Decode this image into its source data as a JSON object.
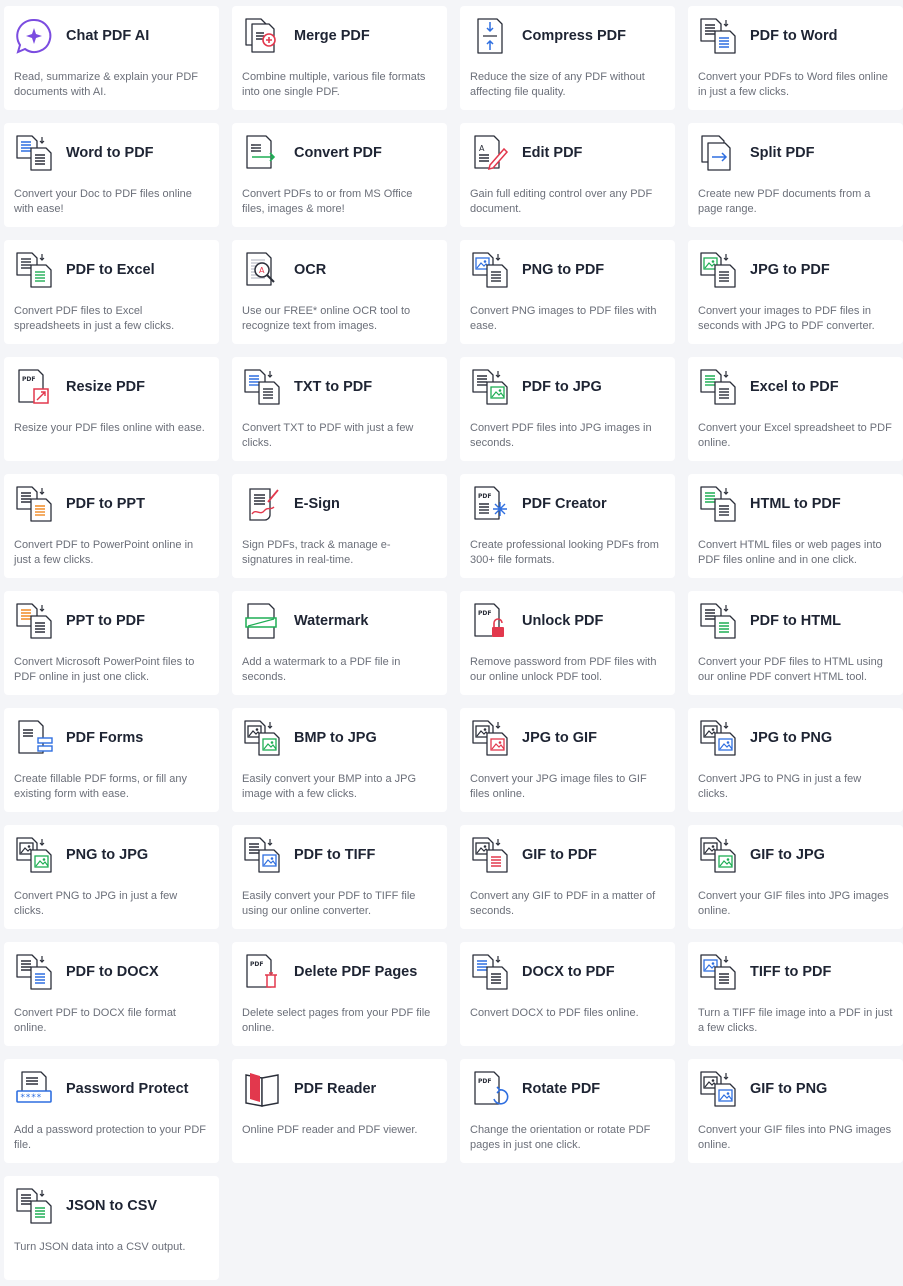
{
  "tools": [
    {
      "title": "Chat PDF AI",
      "desc": "Read, summarize & explain your PDF documents with AI.",
      "icon": "chat-ai-icon"
    },
    {
      "title": "Merge PDF",
      "desc": "Combine multiple, various file formats into one single PDF.",
      "icon": "merge-icon"
    },
    {
      "title": "Compress PDF",
      "desc": "Reduce the size of any PDF without affecting file quality.",
      "icon": "compress-icon"
    },
    {
      "title": "PDF to Word",
      "desc": "Convert your PDFs to Word files online in just a few clicks.",
      "icon": "pdf-to-word-icon"
    },
    {
      "title": "Word to PDF",
      "desc": "Convert your Doc to PDF files online with ease!",
      "icon": "word-to-pdf-icon"
    },
    {
      "title": "Convert PDF",
      "desc": "Convert PDFs to or from MS Office files, images & more!",
      "icon": "convert-icon"
    },
    {
      "title": "Edit PDF",
      "desc": "Gain full editing control over any PDF document.",
      "icon": "edit-icon"
    },
    {
      "title": "Split PDF",
      "desc": "Create new PDF documents from a page range.",
      "icon": "split-icon"
    },
    {
      "title": "PDF to Excel",
      "desc": "Convert PDF files to Excel spreadsheets in just a few clicks.",
      "icon": "pdf-to-excel-icon"
    },
    {
      "title": "OCR",
      "desc": "Use our FREE* online OCR tool to recognize text from images.",
      "icon": "ocr-icon"
    },
    {
      "title": "PNG to PDF",
      "desc": "Convert PNG images to PDF files with ease.",
      "icon": "png-to-pdf-icon"
    },
    {
      "title": "JPG to PDF",
      "desc": "Convert your images to PDF files in seconds with JPG to PDF converter.",
      "icon": "jpg-to-pdf-icon"
    },
    {
      "title": "Resize PDF",
      "desc": "Resize your PDF files online with ease.",
      "icon": "resize-icon"
    },
    {
      "title": "TXT to PDF",
      "desc": "Convert TXT to PDF with just a few clicks.",
      "icon": "txt-to-pdf-icon"
    },
    {
      "title": "PDF to JPG",
      "desc": "Convert PDF files into JPG images in seconds.",
      "icon": "pdf-to-jpg-icon"
    },
    {
      "title": "Excel to PDF",
      "desc": "Convert your Excel spreadsheet to PDF online.",
      "icon": "excel-to-pdf-icon"
    },
    {
      "title": "PDF to PPT",
      "desc": "Convert PDF to PowerPoint online in just a few clicks.",
      "icon": "pdf-to-ppt-icon"
    },
    {
      "title": "E-Sign",
      "desc": "Sign PDFs, track & manage e-signatures in real-time.",
      "icon": "esign-icon"
    },
    {
      "title": "PDF Creator",
      "desc": "Create professional looking PDFs from 300+ file formats.",
      "icon": "pdf-creator-icon"
    },
    {
      "title": "HTML to PDF",
      "desc": "Convert HTML files or web pages into PDF files online and in one click.",
      "icon": "html-to-pdf-icon"
    },
    {
      "title": "PPT to PDF",
      "desc": "Convert Microsoft PowerPoint files to PDF online in just one click.",
      "icon": "ppt-to-pdf-icon"
    },
    {
      "title": "Watermark",
      "desc": "Add a watermark to a PDF file in seconds.",
      "icon": "watermark-icon"
    },
    {
      "title": "Unlock PDF",
      "desc": "Remove password from PDF files with our online unlock PDF tool.",
      "icon": "unlock-icon"
    },
    {
      "title": "PDF to HTML",
      "desc": "Convert your PDF files to HTML using our online PDF convert HTML tool.",
      "icon": "pdf-to-html-icon"
    },
    {
      "title": "PDF Forms",
      "desc": "Create fillable PDF forms, or fill any existing form with ease.",
      "icon": "forms-icon"
    },
    {
      "title": "BMP to JPG",
      "desc": "Easily convert your BMP into a JPG image with a few clicks.",
      "icon": "bmp-to-jpg-icon"
    },
    {
      "title": "JPG to GIF",
      "desc": "Convert your JPG image files to GIF files online.",
      "icon": "jpg-to-gif-icon"
    },
    {
      "title": "JPG to PNG",
      "desc": "Convert JPG to PNG in just a few clicks.",
      "icon": "jpg-to-png-icon"
    },
    {
      "title": "PNG to JPG",
      "desc": "Convert PNG to JPG in just a few clicks.",
      "icon": "png-to-jpg-icon"
    },
    {
      "title": "PDF to TIFF",
      "desc": "Easily convert your PDF to TIFF file using our online converter.",
      "icon": "pdf-to-tiff-icon"
    },
    {
      "title": "GIF to PDF",
      "desc": "Convert any GIF to PDF in a matter of seconds.",
      "icon": "gif-to-pdf-icon"
    },
    {
      "title": "GIF to JPG",
      "desc": "Convert your GIF files into JPG images online.",
      "icon": "gif-to-jpg-icon"
    },
    {
      "title": "PDF to DOCX",
      "desc": "Convert PDF to DOCX file format online.",
      "icon": "pdf-to-docx-icon"
    },
    {
      "title": "Delete PDF Pages",
      "desc": "Delete select pages from your PDF file online.",
      "icon": "delete-pages-icon"
    },
    {
      "title": "DOCX to PDF",
      "desc": "Convert DOCX to PDF files online.",
      "icon": "docx-to-pdf-icon"
    },
    {
      "title": "TIFF to PDF",
      "desc": "Turn a TIFF file image into a PDF in just a few clicks.",
      "icon": "tiff-to-pdf-icon"
    },
    {
      "title": "Password Protect",
      "desc": "Add a password protection to your PDF file.",
      "icon": "password-icon"
    },
    {
      "title": "PDF Reader",
      "desc": "Online PDF reader and PDF viewer.",
      "icon": "reader-icon"
    },
    {
      "title": "Rotate PDF",
      "desc": "Change the orientation or rotate PDF pages in just one click.",
      "icon": "rotate-icon"
    },
    {
      "title": "GIF to PNG",
      "desc": "Convert your GIF files into PNG images online.",
      "icon": "gif-to-png-icon"
    },
    {
      "title": "JSON to CSV",
      "desc": "Turn JSON data into a CSV output.",
      "icon": "json-to-csv-icon"
    }
  ],
  "colors": {
    "background": "#f4f5f8",
    "card": "#ffffff",
    "title": "#1e2433",
    "desc": "#6b6f79",
    "icon_outline": "#2b2f3a",
    "blue": "#2f6fe0",
    "green": "#1fae55",
    "red": "#e2384d",
    "orange": "#f08a24",
    "purple": "#7b4ce0"
  }
}
